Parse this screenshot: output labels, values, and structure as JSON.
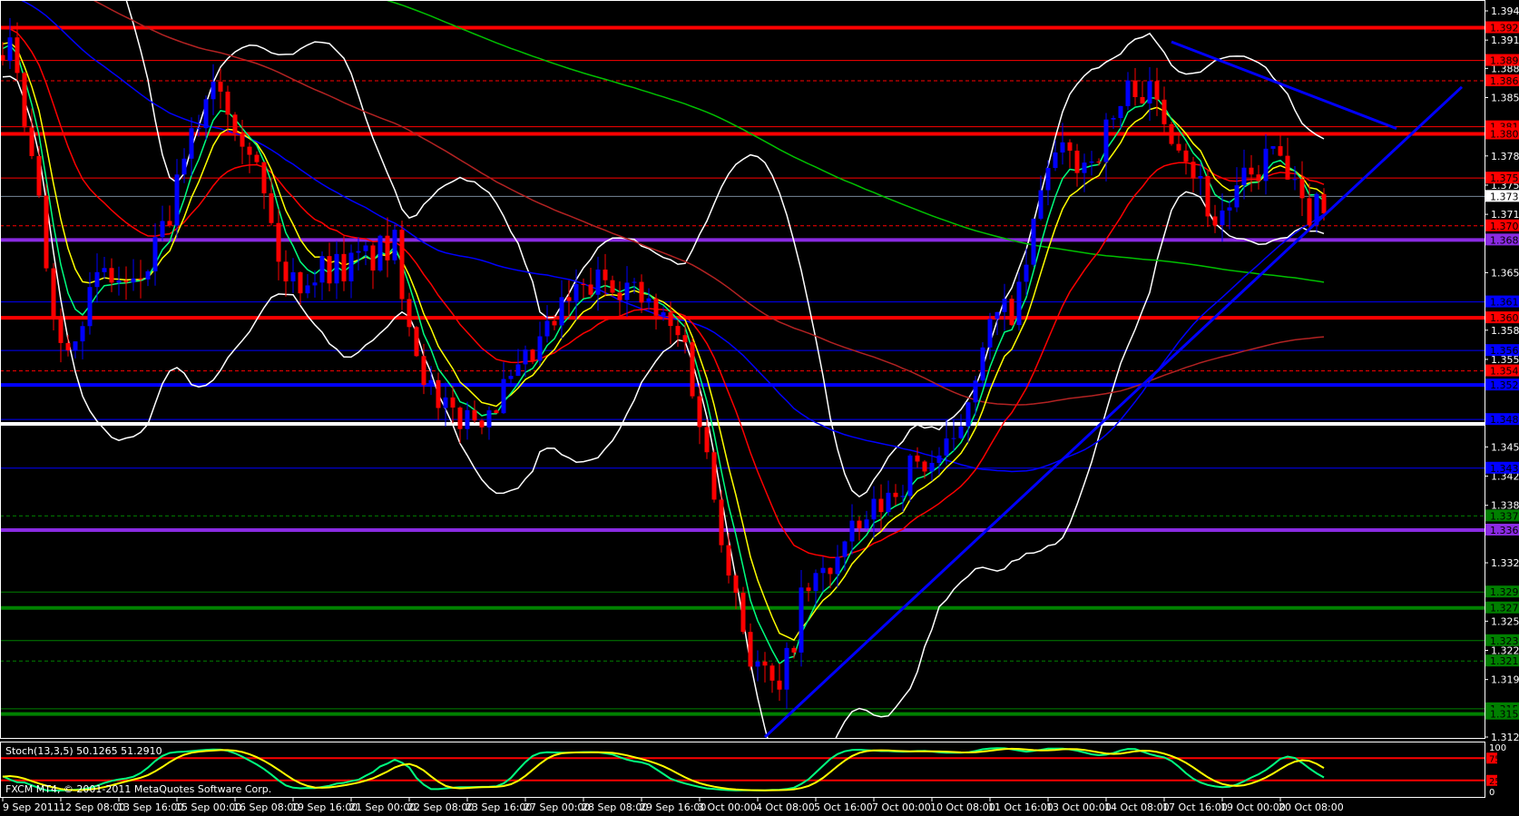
{
  "chart_data": {
    "type": "candlestick",
    "symbol_platform": "FXCM MT4",
    "copyright": "FXCM MT4, © 2001-2011 MetaQuotes Software Corp.",
    "timeframe_hours": 4,
    "ylim": [
      1.3127,
      1.3948
    ],
    "price_ticks": [
      "1.39480",
      "1.39150",
      "1.38830",
      "1.38500",
      "1.37840",
      "1.37510",
      "1.37180",
      "1.36520",
      "1.35870",
      "1.35540",
      "1.34550",
      "1.34220",
      "1.33890",
      "1.33240",
      "1.32580",
      "1.32250",
      "1.31920",
      "1.31270"
    ],
    "time_labels": [
      "9 Sep 2011",
      "12 Sep 08:00",
      "13 Sep 16:00",
      "15 Sep 00:00",
      "16 Sep 08:00",
      "19 Sep 16:00",
      "21 Sep 00:00",
      "22 Sep 08:00",
      "23 Sep 16:00",
      "27 Sep 00:00",
      "28 Sep 08:00",
      "29 Sep 16:00",
      "3 Oct 00:00",
      "4 Oct 08:00",
      "5 Oct 16:00",
      "7 Oct 00:00",
      "10 Oct 08:00",
      "11 Oct 16:00",
      "13 Oct 00:00",
      "14 Oct 08:00",
      "17 Oct 16:00",
      "19 Oct 00:00",
      "20 Oct 08:00"
    ],
    "close_path": [
      [
        0,
        1.3905
      ],
      [
        1,
        1.392
      ],
      [
        5,
        1.372
      ],
      [
        8,
        1.357
      ],
      [
        14,
        1.365
      ],
      [
        18,
        1.363
      ],
      [
        22,
        1.369
      ],
      [
        29,
        1.388
      ],
      [
        34,
        1.38
      ],
      [
        39,
        1.364
      ],
      [
        45,
        1.366
      ],
      [
        48,
        1.366
      ],
      [
        54,
        1.368
      ],
      [
        57,
        1.357
      ],
      [
        60,
        1.349
      ],
      [
        65,
        1.349
      ],
      [
        71,
        1.353
      ],
      [
        78,
        1.362
      ],
      [
        84,
        1.365
      ],
      [
        88,
        1.362
      ],
      [
        94,
        1.357
      ],
      [
        98,
        1.34
      ],
      [
        103,
        1.322
      ],
      [
        107,
        1.317
      ],
      [
        110,
        1.328
      ],
      [
        116,
        1.334
      ],
      [
        120,
        1.338
      ],
      [
        125,
        1.343
      ],
      [
        131,
        1.345
      ],
      [
        135,
        1.358
      ],
      [
        140,
        1.362
      ],
      [
        144,
        1.378
      ],
      [
        150,
        1.378
      ],
      [
        156,
        1.387
      ],
      [
        162,
        1.381
      ],
      [
        167,
        1.371
      ],
      [
        171,
        1.375
      ],
      [
        175,
        1.379
      ],
      [
        179,
        1.372
      ],
      [
        182,
        1.3738
      ]
    ],
    "current_price": "1.37383",
    "levels": [
      {
        "price": "1.39290",
        "color": "#ff0000",
        "style": "thick"
      },
      {
        "price": "1.38920",
        "color": "#ff0000",
        "style": "thin"
      },
      {
        "price": "1.38690",
        "color": "#ff0000",
        "style": "dash"
      },
      {
        "price": "1.38170",
        "color": "#ff0000",
        "style": "thin"
      },
      {
        "price": "1.38090",
        "color": "#ff0000",
        "style": "thick"
      },
      {
        "price": "1.37590",
        "color": "#ff0000",
        "style": "thin"
      },
      {
        "price": "1.37050",
        "color": "#ff0000",
        "style": "dash"
      },
      {
        "price": "1.36890",
        "color": "#8a2be2",
        "style": "thick"
      },
      {
        "price": "1.36190",
        "color": "#0000ff",
        "style": "thin"
      },
      {
        "price": "1.36010",
        "color": "#ff0000",
        "style": "thick"
      },
      {
        "price": "1.35640",
        "color": "#0000ff",
        "style": "thin"
      },
      {
        "price": "1.35410",
        "color": "#ff0000",
        "style": "dash"
      },
      {
        "price": "1.35250",
        "color": "#0000ff",
        "style": "thick"
      },
      {
        "price": "1.34860",
        "color": "#0000ff",
        "style": "thin"
      },
      {
        "price": "1.34810",
        "color": "#ffffff",
        "style": "thick"
      },
      {
        "price": "1.34310",
        "color": "#0000ff",
        "style": "thin"
      },
      {
        "price": "1.33770",
        "color": "#008000",
        "style": "dash"
      },
      {
        "price": "1.33610",
        "color": "#8a2be2",
        "style": "thick"
      },
      {
        "price": "1.32910",
        "color": "#008000",
        "style": "thin"
      },
      {
        "price": "1.32730",
        "color": "#008000",
        "style": "thick"
      },
      {
        "price": "1.32360",
        "color": "#008000",
        "style": "thin"
      },
      {
        "price": "1.32130",
        "color": "#008000",
        "style": "dash"
      },
      {
        "price": "1.31590",
        "color": "#008000",
        "style": "thin"
      },
      {
        "price": "1.31530",
        "color": "#008000",
        "style": "thick"
      }
    ],
    "trendlines": [
      {
        "from": [
          105,
          1.3127
        ],
        "to": [
          201,
          1.3862
        ],
        "color": "#0000ff"
      },
      {
        "from": [
          161,
          1.3913
        ],
        "to": [
          192,
          1.3815
        ],
        "color": "#0000ff"
      }
    ],
    "indicators": {
      "ema_fast": {
        "period": 5,
        "color": "#00ff7f"
      },
      "ema_mid": {
        "period": 8,
        "color": "#ffff00"
      },
      "ema_slow": {
        "period": 21,
        "color": "#ff0000"
      },
      "sma_55": {
        "period": 55,
        "color": "#0000ff"
      },
      "sma_100": {
        "period": 100,
        "color": "#b22222"
      },
      "sma_200": {
        "period": 200,
        "color": "#00c000"
      },
      "bollinger": {
        "period": 20,
        "dev": 2,
        "color": "#ffffff"
      }
    },
    "stochastic": {
      "label": "Stoch(13,3,5) 50.1265 51.2910",
      "levels": [
        "100",
        "75",
        "25",
        "0"
      ],
      "main_color": "#00ff7f",
      "signal_color": "#ffff00"
    },
    "bull_color": "#0000ff",
    "bear_color": "#ff0000"
  }
}
